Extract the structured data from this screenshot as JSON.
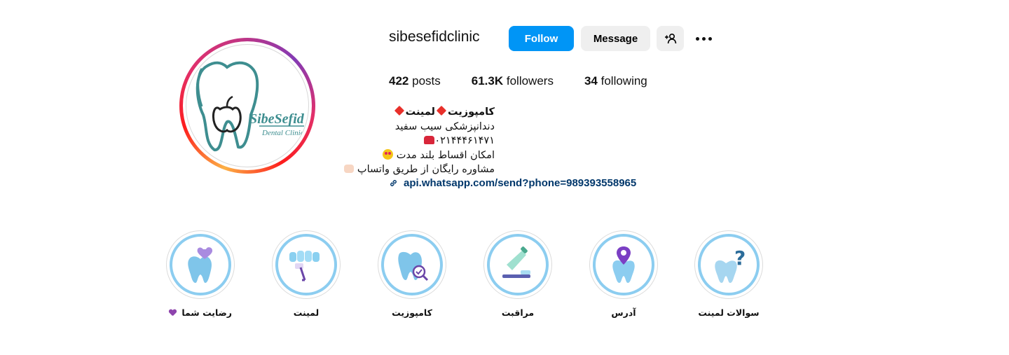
{
  "profile": {
    "username": "sibesefidclinic",
    "logo_text": "SibeSefid",
    "logo_subtext": "Dental Clinic"
  },
  "actions": {
    "follow_label": "Follow",
    "message_label": "Message",
    "add_user_icon": "person-add-icon",
    "more_icon": "more-options-icon"
  },
  "stats": {
    "posts_count": "422",
    "posts_label": "posts",
    "followers_count": "61.3K",
    "followers_label": "followers",
    "following_count": "34",
    "following_label": "following"
  },
  "bio": {
    "name_part1": "کامپوزیت",
    "name_part2": "لمینت",
    "line1": "دندانپزشکی سیب سفید",
    "phone": "۰۲۱۴۴۴۶۱۴۷۱",
    "line3": "امکان اقساط بلند مدت",
    "line4": "مشاوره رایگان از طریق واتساپ",
    "link": "api.whatsapp.com/send?phone=989393558965"
  },
  "highlights": [
    {
      "label": "رضایت شما",
      "icon": "tooth-heart-icon"
    },
    {
      "label": "لمینت",
      "icon": "veneers-icon"
    },
    {
      "label": "کامپوزیت",
      "icon": "tooth-magnifier-icon"
    },
    {
      "label": "مراقبت",
      "icon": "toothbrush-paste-icon"
    },
    {
      "label": "آدرس",
      "icon": "tooth-location-icon"
    },
    {
      "label": "سوالات لمینت",
      "icon": "tooth-question-icon"
    }
  ],
  "colors": {
    "follow_button": "#0095f6",
    "link": "#00376b",
    "highlight_ring": "#8ccdf0",
    "logo_teal": "#3e8e90"
  }
}
